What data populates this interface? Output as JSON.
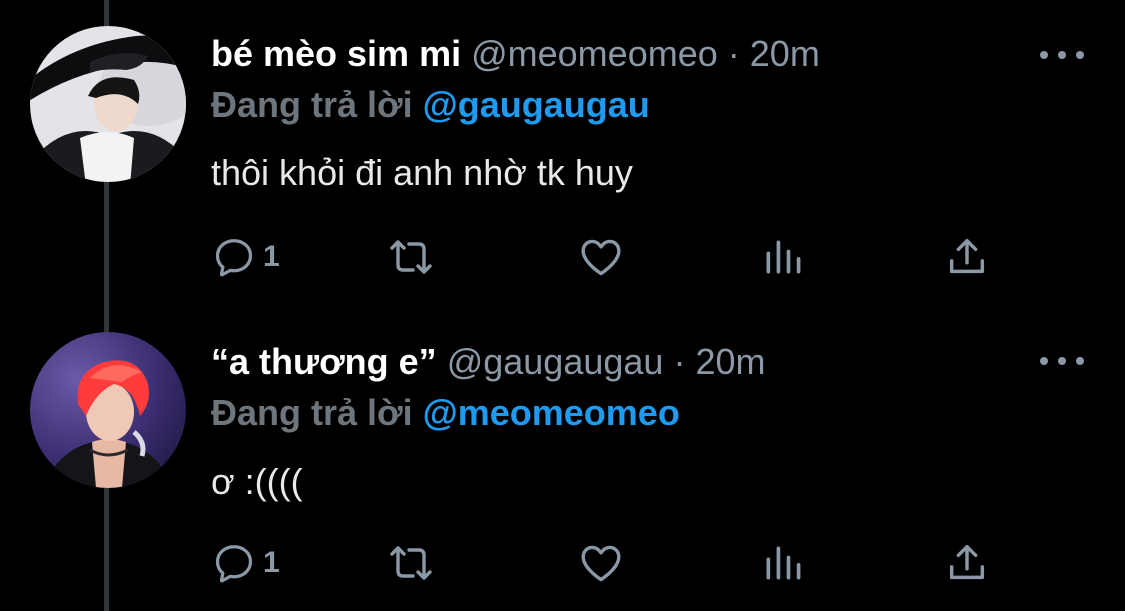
{
  "colors": {
    "background": "#000000",
    "thread_line": "#333639",
    "secondary_text": "#8b98a5",
    "reply_prefix": "#6e767d",
    "mention_link": "#1d9bf0",
    "primary_text": "#e7e9ea"
  },
  "tweets": [
    {
      "avatar_icon": "avatar-photo-hat",
      "display_name": "bé mèo sim mi",
      "handle": "@meomeomeo",
      "separator": "·",
      "time": "20m",
      "reply_prefix": "Đang trả lời",
      "reply_to": "@gaugaugau",
      "text": "thôi khỏi đi anh nhờ tk huy",
      "actions": {
        "reply_icon": "reply-icon",
        "reply_count": "1",
        "retweet_icon": "retweet-icon",
        "like_icon": "heart-icon",
        "views_icon": "views-icon",
        "share_icon": "share-icon"
      }
    },
    {
      "avatar_icon": "avatar-photo-red-hair",
      "display_name": "“a thương e”",
      "handle": "@gaugaugau",
      "separator": "·",
      "time": "20m",
      "reply_prefix": "Đang trả lời",
      "reply_to": "@meomeomeo",
      "text": "ơ :((((",
      "actions": {
        "reply_icon": "reply-icon",
        "reply_count": "1",
        "retweet_icon": "retweet-icon",
        "like_icon": "heart-icon",
        "views_icon": "views-icon",
        "share_icon": "share-icon"
      }
    }
  ]
}
